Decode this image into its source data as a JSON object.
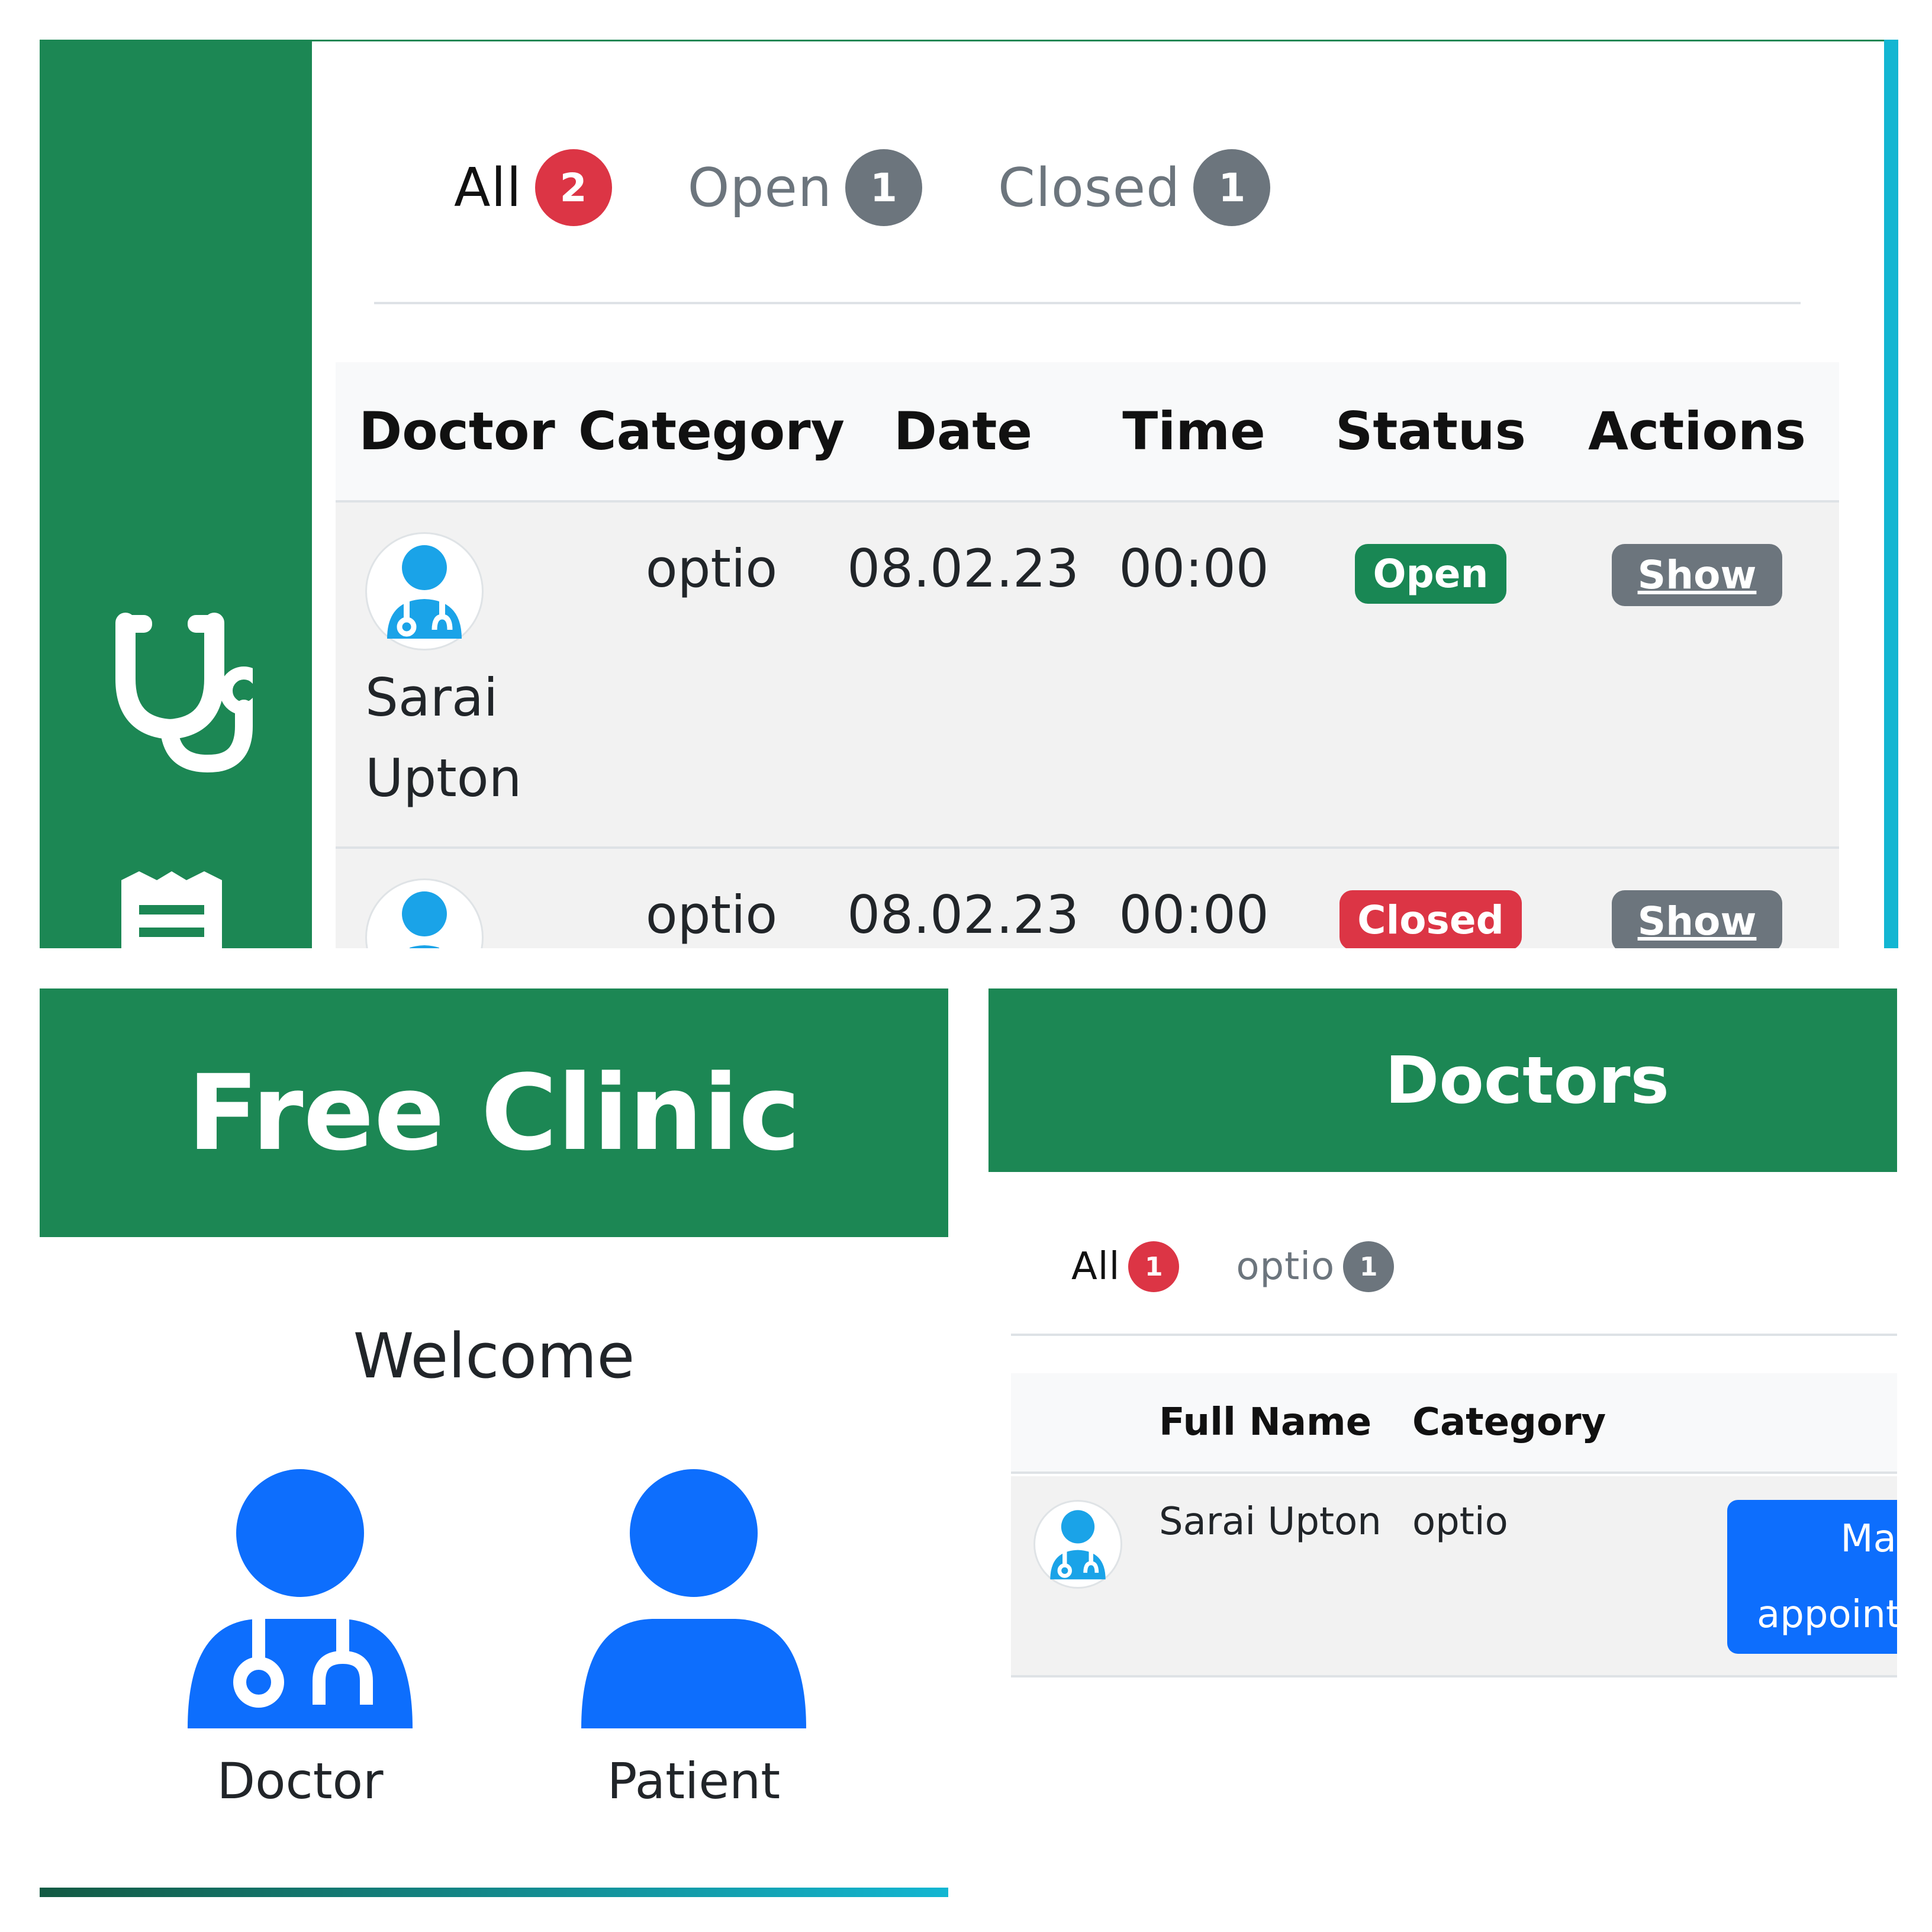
{
  "appointments": {
    "tabs": [
      {
        "label": "All",
        "count": "2"
      },
      {
        "label": "Open",
        "count": "1"
      },
      {
        "label": "Closed",
        "count": "1"
      }
    ],
    "columns": [
      "Doctor",
      "Category",
      "Date",
      "Time",
      "Status",
      "Actions"
    ],
    "rows": [
      {
        "doctor_first": "Sarai",
        "doctor_last": "Upton",
        "category": "optio",
        "date": "08.02.23",
        "time": "00:00",
        "status": "Open",
        "action": "Show"
      },
      {
        "category": "optio",
        "date": "08.02.23",
        "time": "00:00",
        "status": "Closed",
        "action": "Show"
      }
    ],
    "sidebar_icons": [
      "stethoscope-icon",
      "clipboard-list-icon"
    ]
  },
  "clinic": {
    "title": "Free Clinic",
    "welcome": "Welcome",
    "roles": [
      {
        "label": "Doctor",
        "icon": "user-doctor-icon"
      },
      {
        "label": "Patient",
        "icon": "user-icon"
      }
    ]
  },
  "doctors": {
    "title": "Doctors",
    "tabs": [
      {
        "label": "All",
        "count": "1"
      },
      {
        "label": "optio",
        "count": "1"
      }
    ],
    "columns": [
      "Full Name",
      "Category"
    ],
    "rows": [
      {
        "full_name": "Sarai Upton",
        "category": "optio",
        "action_line1": "Make",
        "action_line2": "appoint"
      }
    ]
  },
  "colors": {
    "brand_green": "#1c8754",
    "accent_cyan": "#13b6d2",
    "danger": "#dc3545",
    "secondary": "#6c757d",
    "success": "#198754",
    "primary": "#0d6efd",
    "avatar_blue": "#1aa3e8"
  }
}
